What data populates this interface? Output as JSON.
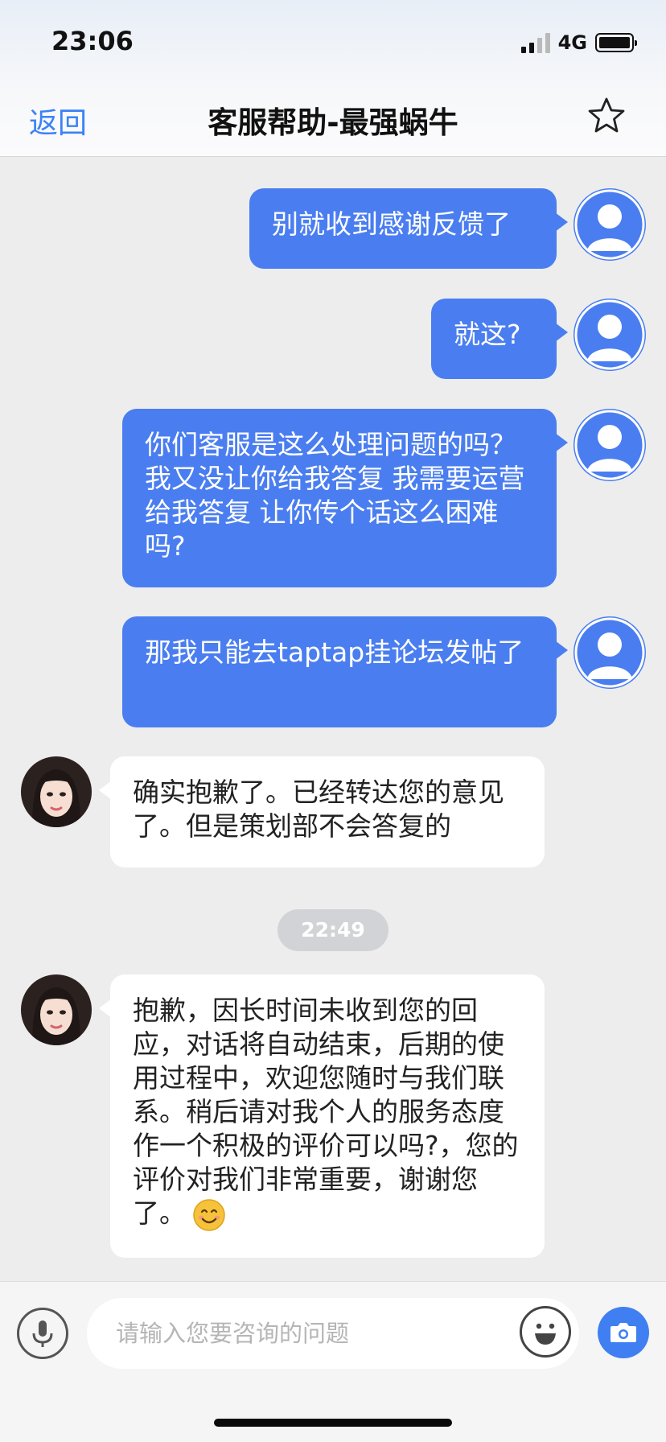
{
  "status_bar": {
    "time": "23:06",
    "network": "4G",
    "icons": [
      "signal-icon",
      "battery-icon"
    ]
  },
  "header": {
    "back_label": "返回",
    "title": "客服帮助-最强蜗牛",
    "favorite_icon": "star-outline-icon"
  },
  "messages": [
    {
      "side": "out",
      "text": "别就收到感谢反馈了"
    },
    {
      "side": "out",
      "text": "就这?"
    },
    {
      "side": "out",
      "text": "你们客服是这么处理问题的吗？我又没让你给我答复 我需要运营给我答复 让你传个话这么困难吗?"
    },
    {
      "side": "out",
      "text": "那我只能去taptap挂论坛发帖了"
    },
    {
      "side": "in",
      "text": "确实抱歉了。已经转达您的意见了。但是策划部不会答复的"
    },
    {
      "side": "in",
      "text": "抱歉，因长时间未收到您的回应，对话将自动结束，后期的使用过程中，欢迎您随时与我们联系。稍后请对我个人的服务态度作一个积极的评价可以吗?，您的评价对我们非常重要，谢谢您了。",
      "emoji": "smiling-face-emoji"
    }
  ],
  "timestamp": "22:49",
  "input": {
    "placeholder": "请输入您要咨询的问题",
    "value": "",
    "icons": [
      "microphone-icon",
      "emoji-icon",
      "camera-icon"
    ]
  },
  "colors": {
    "accent": "#4a7ef0",
    "link": "#3b82f6",
    "background": "#ededed",
    "incoming_bubble": "#ffffff"
  }
}
